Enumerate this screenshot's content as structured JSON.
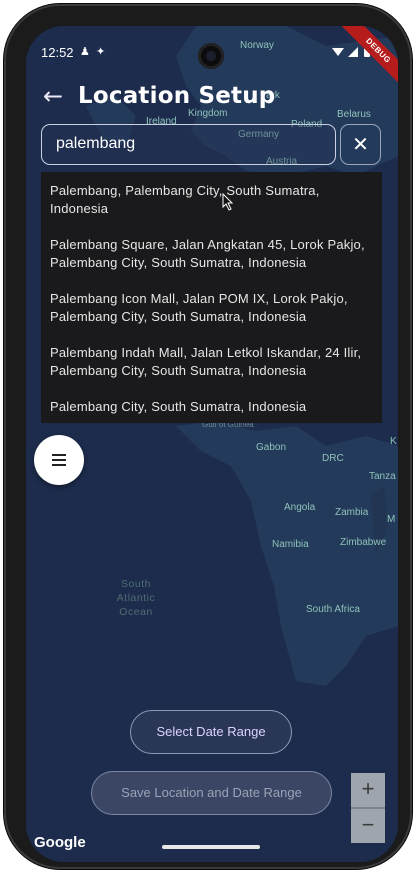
{
  "status_bar": {
    "time": "12:52",
    "debug_badge": "DEBUG"
  },
  "header": {
    "title": "Location Setup"
  },
  "search": {
    "value": "palembang"
  },
  "suggestions": [
    "Palembang, Palembang City, South Sumatra, Indonesia",
    "Palembang Square, Jalan Angkatan 45, Lorok Pakjo, Palembang City, South Sumatra, Indonesia",
    "Palembang Icon Mall, Jalan POM IX, Lorok Pakjo, Palembang City, South Sumatra, Indonesia",
    "Palembang Indah Mall, Jalan Letkol Iskandar, 24 Ilir, Palembang City, South Sumatra, Indonesia",
    "Palembang City, South Sumatra, Indonesia"
  ],
  "map_labels": {
    "norway": "Norway",
    "kingdom": "Kingdom",
    "ireland": "Ireland",
    "denmark": "ark",
    "germany": "Germany",
    "poland": "Poland",
    "belarus": "Belarus",
    "austria": "Austria",
    "gulf": "Gulf of Guinea",
    "gabon": "Gabon",
    "drc": "DRC",
    "tanzania": "Tanza",
    "angola": "Angola",
    "zambia": "Zambia",
    "mozambique": "M",
    "namibia": "Namibia",
    "zimbabwe": "Zimbabwe",
    "south_africa": "South Africa",
    "ocean": [
      "South",
      "Atlantic",
      "Ocean"
    ],
    "kenya": "K"
  },
  "buttons": {
    "select_date": "Select Date Range",
    "save": "Save Location and Date Range"
  },
  "zoom": {
    "in": "+",
    "out": "−"
  },
  "attribution": "Google",
  "icons": {
    "back": "arrow-left-icon",
    "clear": "close-icon",
    "menu": "hamburger-menu-icon",
    "cursor": "mouse-pointer-icon"
  },
  "colors": {
    "map_water": "#1d2c4d",
    "land": "#233653",
    "accent_text": "#dcd3ff"
  }
}
